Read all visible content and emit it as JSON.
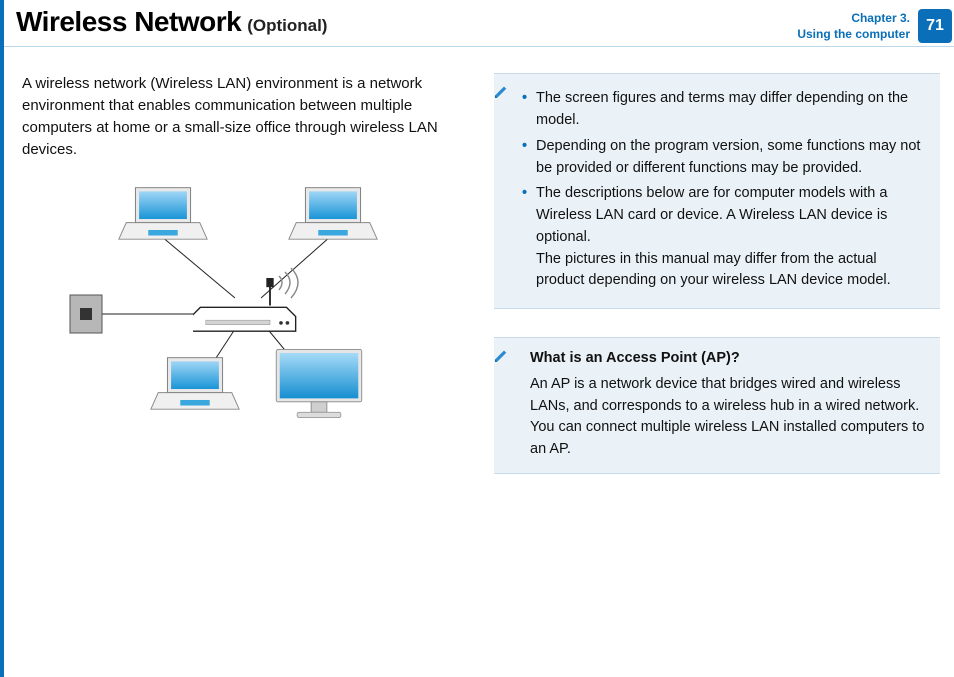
{
  "header": {
    "title": "Wireless Network",
    "subtitle": "(Optional)",
    "chapter_line1": "Chapter 3.",
    "chapter_line2": "Using the computer",
    "page_number": "71"
  },
  "intro": "A wireless network (Wireless LAN) environment is a network environment that enables communication between multiple computers at home or a small-size office through wireless LAN devices.",
  "notes": {
    "b1": "The screen figures and terms may differ depending on the model.",
    "b2": "Depending on the program version, some functions may not be provided or different functions may be provided.",
    "b3a": "The descriptions below are for computer models with a Wireless LAN card or device. A Wireless LAN device is optional.",
    "b3b": "The pictures in this manual may differ from the actual product depending on your wireless LAN device model."
  },
  "ap": {
    "title": "What is an Access Point (AP)?",
    "body": "An AP is a network device that bridges wired and wireless LANs, and corresponds to a wireless hub in a wired network. You can connect multiple wireless LAN installed computers to an AP."
  }
}
